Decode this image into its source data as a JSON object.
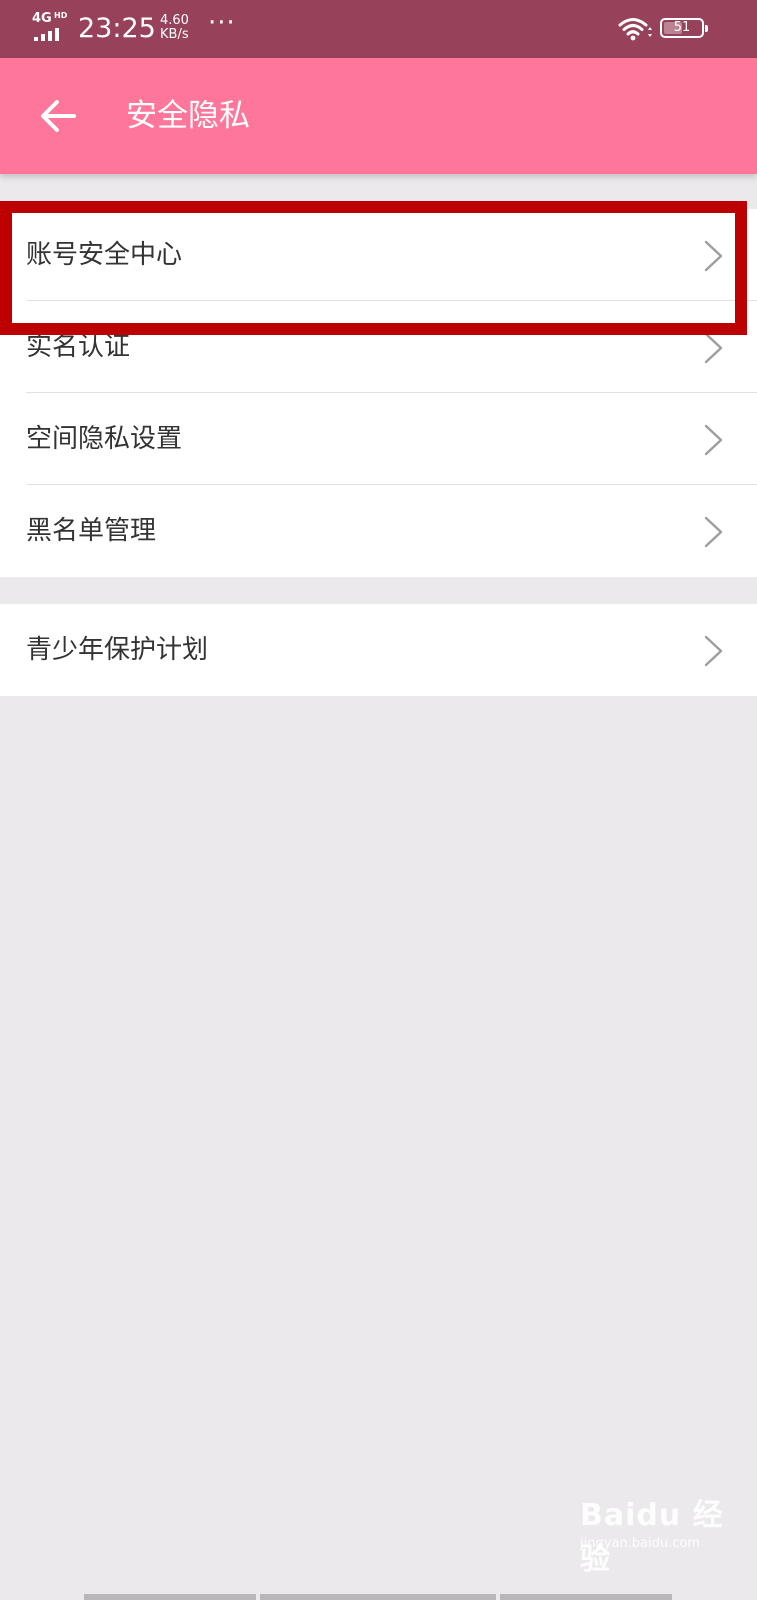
{
  "status_bar": {
    "network_type": "4G",
    "network_hd": "HD",
    "time": "23:25",
    "speed_value": "4.60",
    "speed_unit": "KB/s",
    "more_indicator": "···",
    "battery_level": "51",
    "battery_fraction": 0.51
  },
  "app_bar": {
    "back_icon": "arrow-left-icon",
    "title": "安全隐私"
  },
  "groups": [
    {
      "items": [
        {
          "label": "账号安全中心",
          "icon": "chevron-right-icon"
        },
        {
          "label": "实名认证",
          "icon": "chevron-right-icon"
        },
        {
          "label": "空间隐私设置",
          "icon": "chevron-right-icon"
        },
        {
          "label": "黑名单管理",
          "icon": "chevron-right-icon"
        }
      ]
    },
    {
      "items": [
        {
          "label": "青少年保护计划",
          "icon": "chevron-right-icon"
        }
      ]
    }
  ],
  "watermark": {
    "brand": "Baidu 经验",
    "url": "jingyan.baidu.com"
  },
  "colors": {
    "status_bar": "#97425a",
    "app_bar": "#fe7699",
    "highlight_box": "#bd0000",
    "background": "#ebe9ec"
  }
}
